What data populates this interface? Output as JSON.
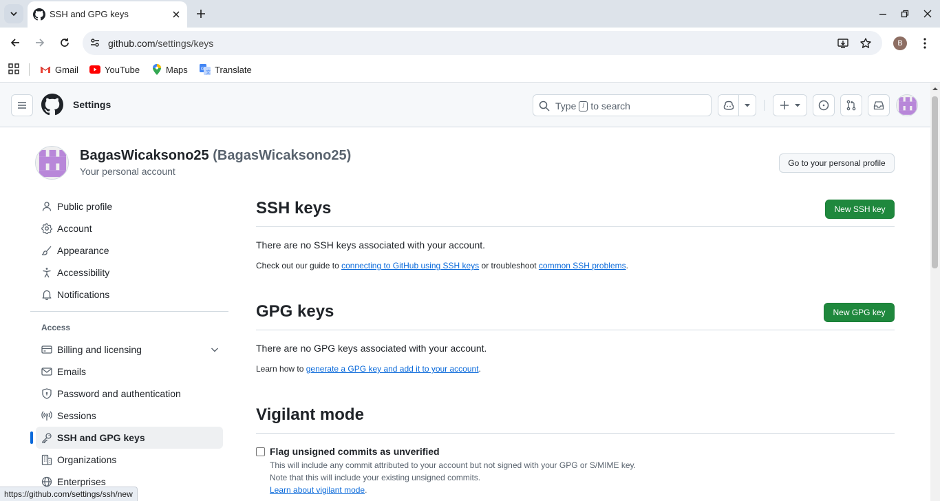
{
  "browser": {
    "tab_title": "SSH and GPG keys",
    "url_domain": "github.com",
    "url_path": "/settings/keys",
    "profile_initial": "B",
    "bookmarks": [
      "Gmail",
      "YouTube",
      "Maps",
      "Translate"
    ],
    "status_url": "https://github.com/settings/ssh/new"
  },
  "header": {
    "title": "Settings",
    "search_prefix": "Type",
    "search_key": "/",
    "search_suffix": "to search"
  },
  "account": {
    "name": "BagasWicaksono25",
    "login": "(BagasWicaksono25)",
    "subtitle": "Your personal account",
    "profile_button": "Go to your personal profile"
  },
  "sidebar": {
    "items": [
      {
        "label": "Public profile",
        "icon": "person-icon"
      },
      {
        "label": "Account",
        "icon": "gear-icon"
      },
      {
        "label": "Appearance",
        "icon": "paintbrush-icon"
      },
      {
        "label": "Accessibility",
        "icon": "accessibility-icon"
      },
      {
        "label": "Notifications",
        "icon": "bell-icon"
      }
    ],
    "access_heading": "Access",
    "access_items": [
      {
        "label": "Billing and licensing",
        "icon": "credit-card-icon"
      },
      {
        "label": "Emails",
        "icon": "mail-icon"
      },
      {
        "label": "Password and authentication",
        "icon": "shield-lock-icon"
      },
      {
        "label": "Sessions",
        "icon": "broadcast-icon"
      },
      {
        "label": "SSH and GPG keys",
        "icon": "key-icon"
      },
      {
        "label": "Organizations",
        "icon": "organization-icon"
      },
      {
        "label": "Enterprises",
        "icon": "globe-icon"
      }
    ]
  },
  "ssh": {
    "title": "SSH keys",
    "button": "New SSH key",
    "empty": "There are no SSH keys associated with your account.",
    "guide_prefix": "Check out our guide to ",
    "guide_link": "connecting to GitHub using SSH keys",
    "guide_middle": " or troubleshoot ",
    "guide_link2": "common SSH problems",
    "guide_suffix": "."
  },
  "gpg": {
    "title": "GPG keys",
    "button": "New GPG key",
    "empty": "There are no GPG keys associated with your account.",
    "learn_prefix": "Learn how to ",
    "learn_link": "generate a GPG key and add it to your account",
    "learn_suffix": "."
  },
  "vigilant": {
    "title": "Vigilant mode",
    "checkbox_label": "Flag unsigned commits as unverified",
    "checked": false,
    "note1": "This will include any commit attributed to your account but not signed with your GPG or S/MIME key.",
    "note2": "Note that this will include your existing unsigned commits.",
    "link": "Learn about vigilant mode",
    "link_suffix": "."
  },
  "colors": {
    "primary_button": "#1f883d",
    "link": "#0969da",
    "active_indicator": "#0969da"
  }
}
